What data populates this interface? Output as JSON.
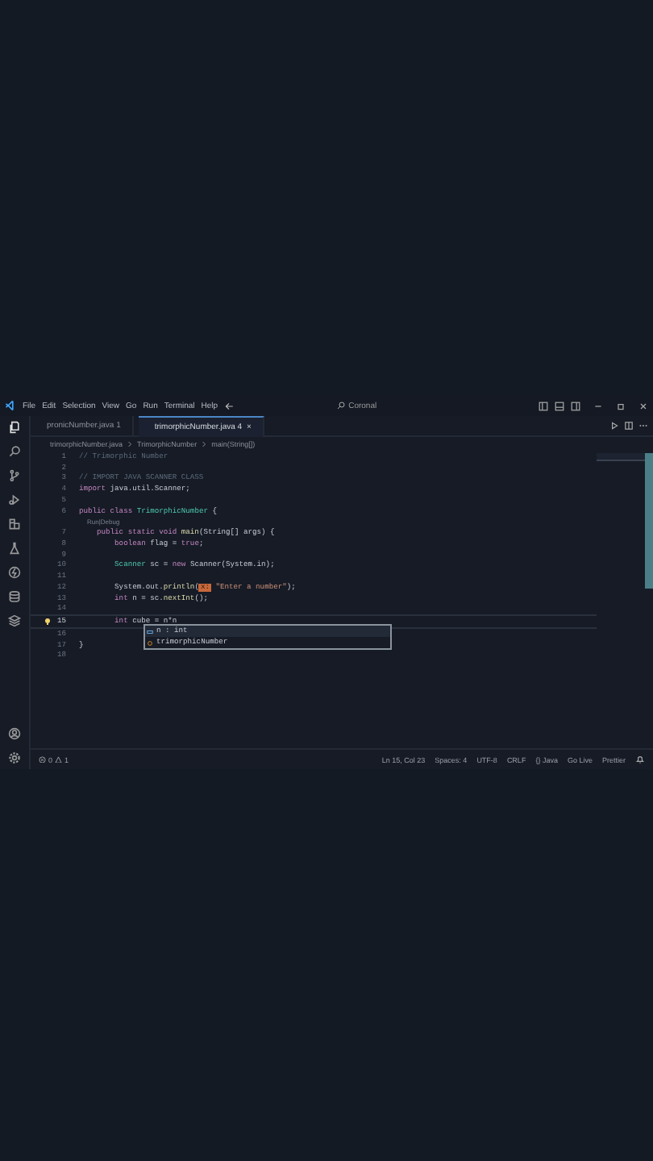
{
  "menu": [
    "File",
    "Edit",
    "Selection",
    "View",
    "Go",
    "Run",
    "Terminal",
    "Help"
  ],
  "search": {
    "value": "Coronal"
  },
  "tabs": [
    {
      "label": "pronicNumber.java",
      "badge": "1",
      "selected": false
    },
    {
      "label": "trimorphicNumber.java",
      "badge": "4",
      "close": "×",
      "selected": true
    }
  ],
  "breadcrumb": [
    "trimorphicNumber.java",
    "TrimorphicNumber",
    "main(String[])"
  ],
  "lines": [
    {
      "number": "1",
      "tokens": [
        {
          "text": "// Trimorphic Number",
          "kind": "comment"
        }
      ]
    },
    {
      "number": "2"
    },
    {
      "number": "3",
      "tokens": [
        {
          "text": "// IMPORT JAVA SCANNER CLASS",
          "kind": "comment"
        }
      ]
    },
    {
      "number": "4",
      "tokens": [
        {
          "text": "import",
          "kind": "keyword"
        },
        {
          "text": " java.util.Scanner;",
          "kind": "plain"
        }
      ]
    },
    {
      "number": "5"
    },
    {
      "number": "6",
      "tokens": [
        {
          "text": "public class",
          "kind": "keyword"
        },
        {
          "text": " TrimorphicNumber",
          "kind": "type"
        },
        {
          "text": " {",
          "kind": "plain"
        }
      ]
    },
    {
      "codelens": "Run|Debug"
    },
    {
      "number": "7",
      "tokens": [
        {
          "text": "    public static void",
          "kind": "keyword"
        },
        {
          "text": " main",
          "kind": "fn"
        },
        {
          "text": "(String[] args) {",
          "kind": "plain"
        }
      ]
    },
    {
      "number": "8",
      "tokens": [
        {
          "text": "        boolean",
          "kind": "keyword"
        },
        {
          "text": " flag = ",
          "kind": "plain"
        },
        {
          "text": "true",
          "kind": "keyword"
        },
        {
          "text": ";",
          "kind": "plain"
        }
      ]
    },
    {
      "number": "9"
    },
    {
      "number": "10",
      "tokens": [
        {
          "text": "        Scanner",
          "kind": "type"
        },
        {
          "text": " sc = ",
          "kind": "plain"
        },
        {
          "text": "new",
          "kind": "keyword"
        },
        {
          "text": " Scanner(System.in);",
          "kind": "plain"
        }
      ]
    },
    {
      "number": "11"
    },
    {
      "number": "12",
      "tokens": [
        {
          "text": "        System.out.",
          "kind": "plain"
        },
        {
          "text": "println",
          "kind": "fn"
        },
        {
          "text": "(",
          "kind": "plain"
        },
        {
          "text": "x:",
          "kind": "hint"
        },
        {
          "text": " \"Enter a number\"",
          "kind": "string"
        },
        {
          "text": ");",
          "kind": "plain"
        }
      ]
    },
    {
      "number": "13",
      "tokens": [
        {
          "text": "        int",
          "kind": "keyword"
        },
        {
          "text": " n = sc.",
          "kind": "plain"
        },
        {
          "text": "nextInt",
          "kind": "fn"
        },
        {
          "text": "();",
          "kind": "plain"
        }
      ]
    },
    {
      "number": "14"
    },
    {
      "number": "15",
      "current": true,
      "tokens": [
        {
          "text": "        int",
          "kind": "keyword"
        },
        {
          "text": " cube = n*n",
          "kind": "plain"
        }
      ]
    },
    {
      "number": "16"
    },
    {
      "number": "17",
      "tokens": [
        {
          "text": "}",
          "kind": "plain"
        }
      ]
    },
    {
      "number": "18"
    }
  ],
  "suggestions": [
    {
      "label": "n : int",
      "kind": "variable",
      "selected": true
    },
    {
      "label": "trimorphicNumber",
      "kind": "class",
      "selected": false
    }
  ],
  "status_left": {
    "errors": "0",
    "warnings": "1"
  },
  "status_right": [
    "Ln 15, Col 23",
    "Spaces: 4",
    "UTF-8",
    "CRLF",
    "{} Java",
    "Go Live",
    "Prettier"
  ]
}
